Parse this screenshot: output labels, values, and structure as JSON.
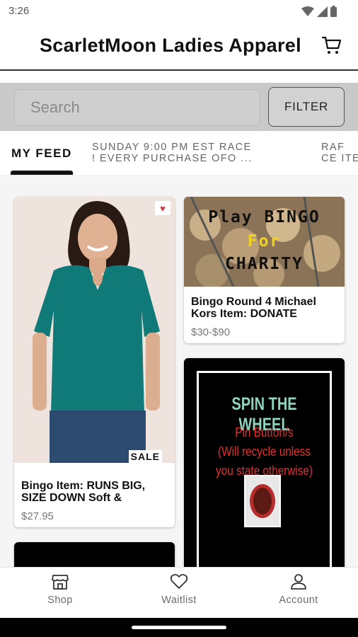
{
  "status_bar": {
    "time": "3:26"
  },
  "header": {
    "title": "ScarletMoon Ladies Apparel",
    "cart_icon": "cart-icon"
  },
  "search": {
    "placeholder": "Search",
    "filter_label": "FILTER"
  },
  "tabs": {
    "active": "MY FEED",
    "items": [
      {
        "label": "MY FEED"
      },
      {
        "line1": "SUNDAY 9:00 PM EST RACE",
        "line2": "! EVERY PURCHASE OFO ..."
      },
      {
        "line1": "RAF",
        "line2": "CE ITE"
      }
    ]
  },
  "feed": {
    "cards": [
      {
        "title": "Bingo Item: RUNS BIG, SIZE DOWN Soft &",
        "price": "$27.95",
        "badge": "SALE",
        "favorited": true
      },
      {
        "title": "Bingo Round 4 Michael Kors Item: DONATE",
        "price": "$30-$90",
        "image_text": [
          "Play BINGO",
          "For",
          "CHARITY"
        ]
      },
      {
        "image_text": [
          "SPIN THE WHEEL",
          "Pin Button/s",
          "(Will recycle unless",
          "you state otherwise)"
        ]
      },
      {}
    ]
  },
  "bottom_nav": {
    "items": [
      {
        "label": "Shop",
        "icon": "shop-icon"
      },
      {
        "label": "Waitlist",
        "icon": "heart-icon"
      },
      {
        "label": "Account",
        "icon": "account-icon"
      }
    ]
  },
  "colors": {
    "accent_heart": "#d23d4e",
    "search_strip": "#c9c9c9",
    "spin_title": "#8fd3bf",
    "spin_red": "#e0302f",
    "bingo_yellow": "#f2d21b"
  }
}
